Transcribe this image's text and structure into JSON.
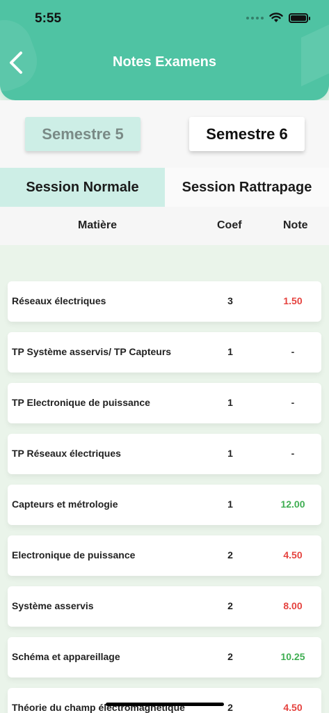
{
  "status_bar": {
    "time": "5:55"
  },
  "header": {
    "title": "Notes Examens"
  },
  "semesters": [
    {
      "label": "Semestre 5"
    },
    {
      "label": "Semestre 6"
    }
  ],
  "sessions": [
    {
      "label": "Session Normale"
    },
    {
      "label": "Session Rattrapage"
    }
  ],
  "columns": {
    "subject": "Matière",
    "coef": "Coef",
    "note": "Note"
  },
  "colors": {
    "accent": "#4fc3a3",
    "selected_bg": "#cdeee6",
    "note_fail": "#e5433f",
    "note_pass": "#3fae52"
  },
  "rows": [
    {
      "subject": "Réseaux électriques",
      "coef": "3",
      "note": "1.50",
      "status": "red"
    },
    {
      "subject": "TP Système asservis/ TP Capteurs",
      "coef": "1",
      "note": "-",
      "status": "dash"
    },
    {
      "subject": "TP Electronique de puissance",
      "coef": "1",
      "note": "-",
      "status": "dash"
    },
    {
      "subject": "TP Réseaux électriques",
      "coef": "1",
      "note": "-",
      "status": "dash"
    },
    {
      "subject": "Capteurs et  métrologie",
      "coef": "1",
      "note": "12.00",
      "status": "green"
    },
    {
      "subject": "Electronique de puissance",
      "coef": "2",
      "note": "4.50",
      "status": "red"
    },
    {
      "subject": "Système asservis",
      "coef": "2",
      "note": "8.00",
      "status": "red"
    },
    {
      "subject": "Schéma et appareillage",
      "coef": "2",
      "note": "10.25",
      "status": "green"
    },
    {
      "subject": "Théorie du champ électromagnétique",
      "coef": "2",
      "note": "4.50",
      "status": "red"
    }
  ]
}
